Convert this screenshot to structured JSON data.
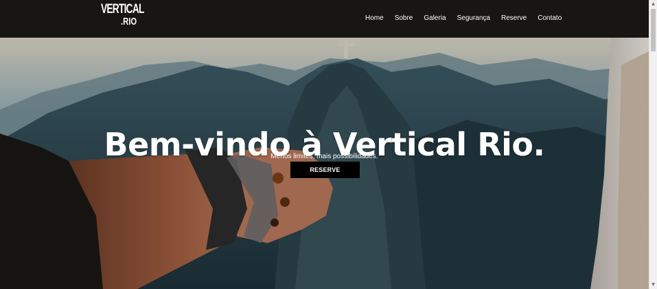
{
  "brand": {
    "logo_top": "VERTICAL",
    "logo_bottom": ".RIO"
  },
  "nav": {
    "items": [
      {
        "label": "Home"
      },
      {
        "label": "Sobre"
      },
      {
        "label": "Galeria"
      },
      {
        "label": "Segurança"
      },
      {
        "label": "Reserve"
      },
      {
        "label": "Contato"
      }
    ]
  },
  "hero": {
    "title": "Bem-vindo à Vertical Rio.",
    "subtitle": "Menos limites, mais possibilidades.",
    "button_label": "RESERVE"
  },
  "scrollbar": {
    "up_icon": "▲",
    "down_icon": "▼"
  },
  "colors": {
    "header_bg": "#171615",
    "button_bg": "#000000",
    "text": "#ffffff"
  }
}
